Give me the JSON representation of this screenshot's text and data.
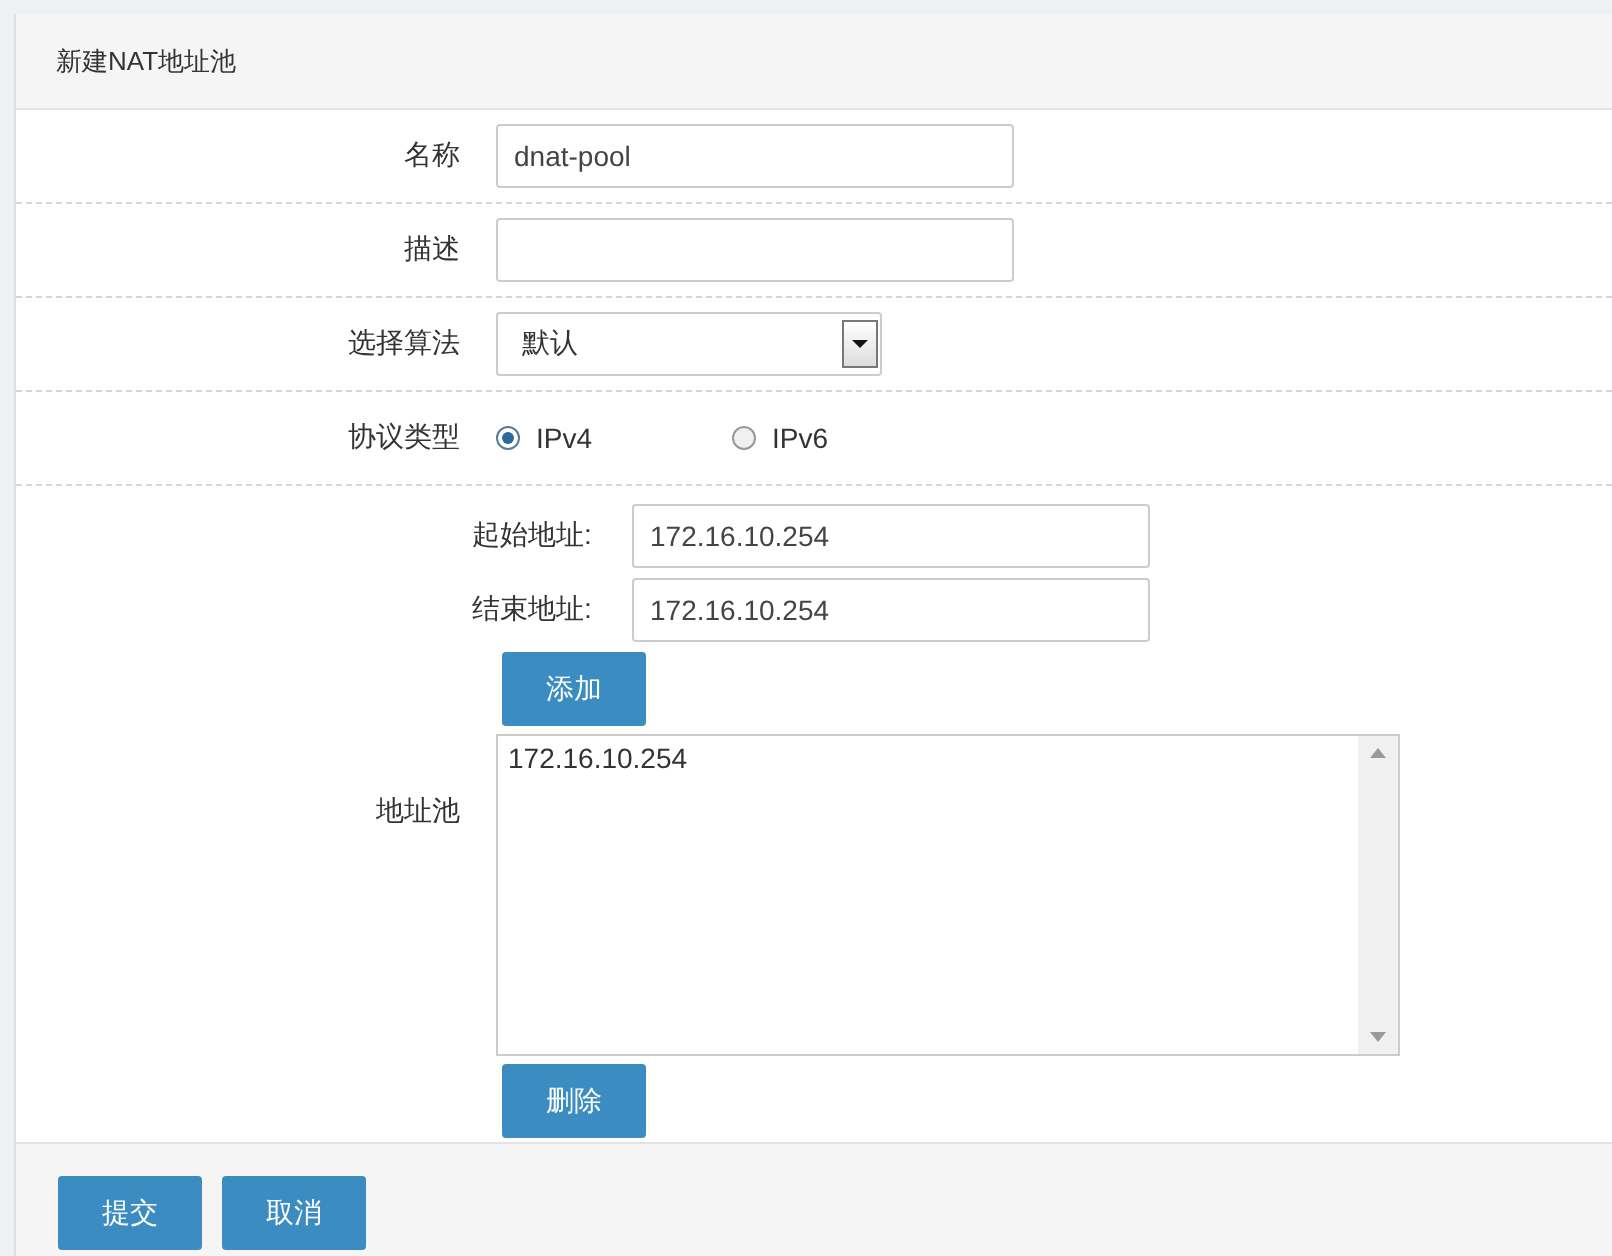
{
  "panel": {
    "title": "新建NAT地址池"
  },
  "fields": [
    {
      "kind": "text",
      "label": "名称",
      "value": "dnat-pool"
    },
    {
      "kind": "text",
      "label": "描述"
    },
    {
      "kind": "select",
      "label": "选择算法",
      "value": "默认"
    },
    {
      "kind": "radio",
      "label": "协议类型",
      "options": [
        {
          "label": "IPv4",
          "selected": true
        },
        {
          "label": "IPv6",
          "selected": false
        }
      ]
    }
  ],
  "range": {
    "start_label": "起始地址:",
    "start_value": "172.16.10.254",
    "end_label": "结束地址:",
    "end_value": "172.16.10.254",
    "add_button": "添加"
  },
  "pool": {
    "label": "地址池",
    "entries": [
      "172.16.10.254"
    ],
    "delete_button": "删除"
  },
  "actions": [
    "提交",
    "取消"
  ]
}
